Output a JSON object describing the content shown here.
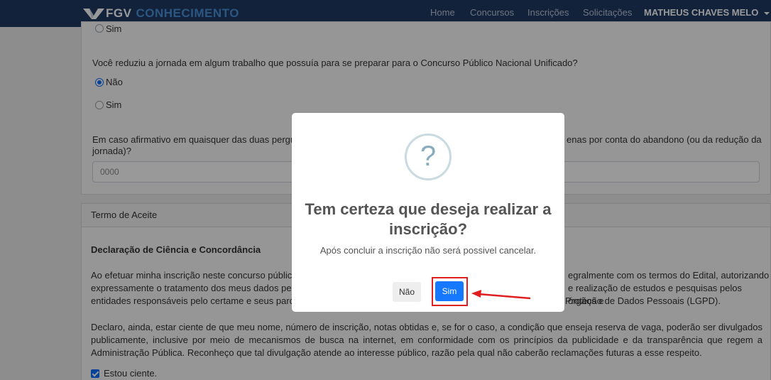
{
  "navbar": {
    "brand_fgv": "FGV",
    "brand_con": "CONHECIMENTO",
    "links": [
      "Home",
      "Concursos",
      "Inscrições",
      "Solicitações"
    ],
    "user": "MATHEUS CHAVES MELO"
  },
  "form": {
    "prev_option": "Sim",
    "question1": "Você reduziu a jornada em algum trabalho que possuía para se preparar para o Concurso Público Nacional Unificado?",
    "q1_options": [
      {
        "label": "Não",
        "checked": true
      },
      {
        "label": "Sim",
        "checked": false
      }
    ],
    "question2_left": "Em caso afirmativo em quaisquer das duas pergu",
    "question2_right": "enas por conta do abandono (ou da redução da",
    "question2_line2": "jornada)?",
    "input_placeholder": "0000"
  },
  "terms": {
    "header": "Termo de Aceite",
    "title": "Declaração de Ciência e Concordância",
    "p1_l1_left": "Ao efetuar minha inscrição neste concurso público",
    "p1_l1_right": "egralmente com os termos do Edital, autorizando",
    "p1_l2_left": "expressamente o tratamento dos meus dados pesso",
    "p1_l2_right": "e realização de estudos e pesquisas pelos órgãos e",
    "p1_l3_left": "entidades responsáveis pelo certame e seus parceiro",
    "p1_l3_right": "Proteção de Dados Pessoais (LGPD).",
    "p2": "Declaro, ainda, estar ciente de que meu nome, número de inscrição, notas obtidas e, se for o caso, a condição que enseja reserva de vaga, poderão ser divulgados publicamente, inclusive por meio de mecanismos de busca na internet, em conformidade com os princípios da publicidade e da transparência que regem a Administração Pública. Reconheço que tal divulgação atende ao interesse público, razão pela qual não caberão reclamações futuras a esse respeito.",
    "checkbox_label": "Estou ciente."
  },
  "modal": {
    "icon": "?",
    "title": "Tem certeza que deseja realizar a inscrição?",
    "text": "Após concluir a inscrição não será possivel cancelar.",
    "btn_no": "Não",
    "btn_yes": "Sim"
  },
  "colors": {
    "navbar": "#1f3a63",
    "brand_accent": "#4a90d9",
    "primary": "#1677ff",
    "highlight": "#e02020"
  }
}
